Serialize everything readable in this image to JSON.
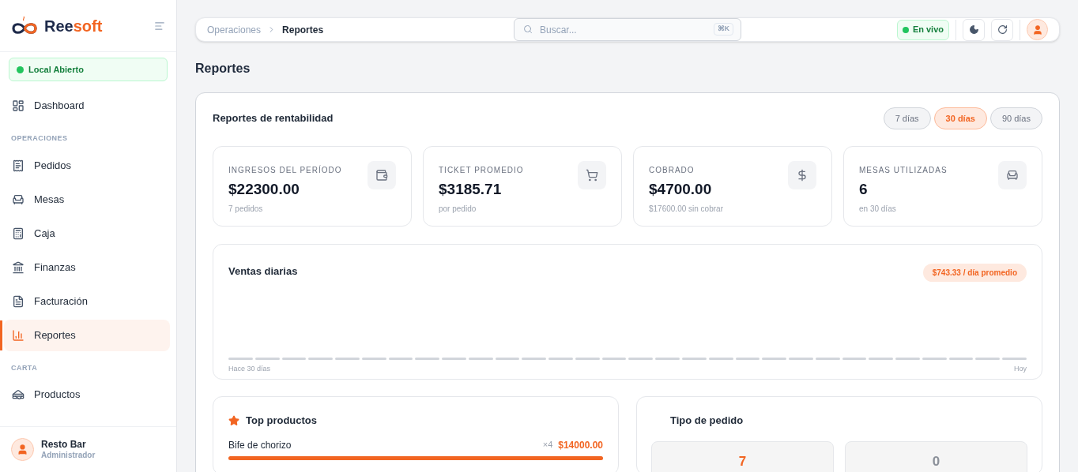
{
  "sidebar": {
    "brand": {
      "first": "Ree",
      "second": "soft"
    },
    "status": {
      "label": "Local Abierto",
      "on": true
    },
    "sections": [
      {
        "items": [
          {
            "label": "Dashboard",
            "selected": false
          }
        ]
      },
      {
        "heading": "OPERACIONES",
        "items": [
          {
            "label": "Pedidos",
            "selected": false
          },
          {
            "label": "Mesas",
            "selected": false
          },
          {
            "label": "Caja",
            "selected": false
          },
          {
            "label": "Finanzas",
            "selected": false
          },
          {
            "label": "Facturación",
            "selected": false
          },
          {
            "label": "Reportes",
            "selected": true
          }
        ]
      },
      {
        "heading": "CARTA",
        "items": [
          {
            "label": "Productos",
            "selected": false
          }
        ]
      }
    ],
    "user": {
      "name": "Resto Bar",
      "role": "Administrador"
    }
  },
  "topbar": {
    "breadcrumb": [
      "Operaciones",
      "Reportes"
    ],
    "search": {
      "placeholder": "Buscar...",
      "shortcut": "⌘K"
    },
    "live": {
      "label": "En vivo",
      "on": true
    }
  },
  "page_title": "Reportes",
  "report": {
    "title": "Reportes de rentabilidad",
    "ranges": [
      {
        "label": "7 días",
        "selected": false
      },
      {
        "label": "30 días",
        "selected": true
      },
      {
        "label": "90 días",
        "selected": false
      }
    ],
    "stats": [
      {
        "label": "INGRESOS DEL PERÍODO",
        "value": "$22300.00",
        "note": "7 pedidos"
      },
      {
        "label": "TICKET PROMEDIO",
        "value": "$3185.71",
        "note": "por pedido"
      },
      {
        "label": "COBRADO",
        "value": "$4700.00",
        "note": "$17600.00 sin cobrar"
      },
      {
        "label": "MESAS UTILIZADAS",
        "value": "6",
        "note": "en 30 días"
      }
    ],
    "daily": {
      "title": "Ventas diarias",
      "badge": "$743.33 / día promedio",
      "start": "Hace 30 días",
      "end": "Hoy"
    },
    "top": {
      "title": "Top productos",
      "items": [
        {
          "name": "Bife de chorizo",
          "qty": "×4",
          "amount": "$14000.00",
          "level": 1
        }
      ]
    },
    "order_type": {
      "title": "Tipo de pedido",
      "tiles": [
        {
          "value": "7",
          "active": true
        },
        {
          "value": "0",
          "active": false
        }
      ]
    }
  }
}
